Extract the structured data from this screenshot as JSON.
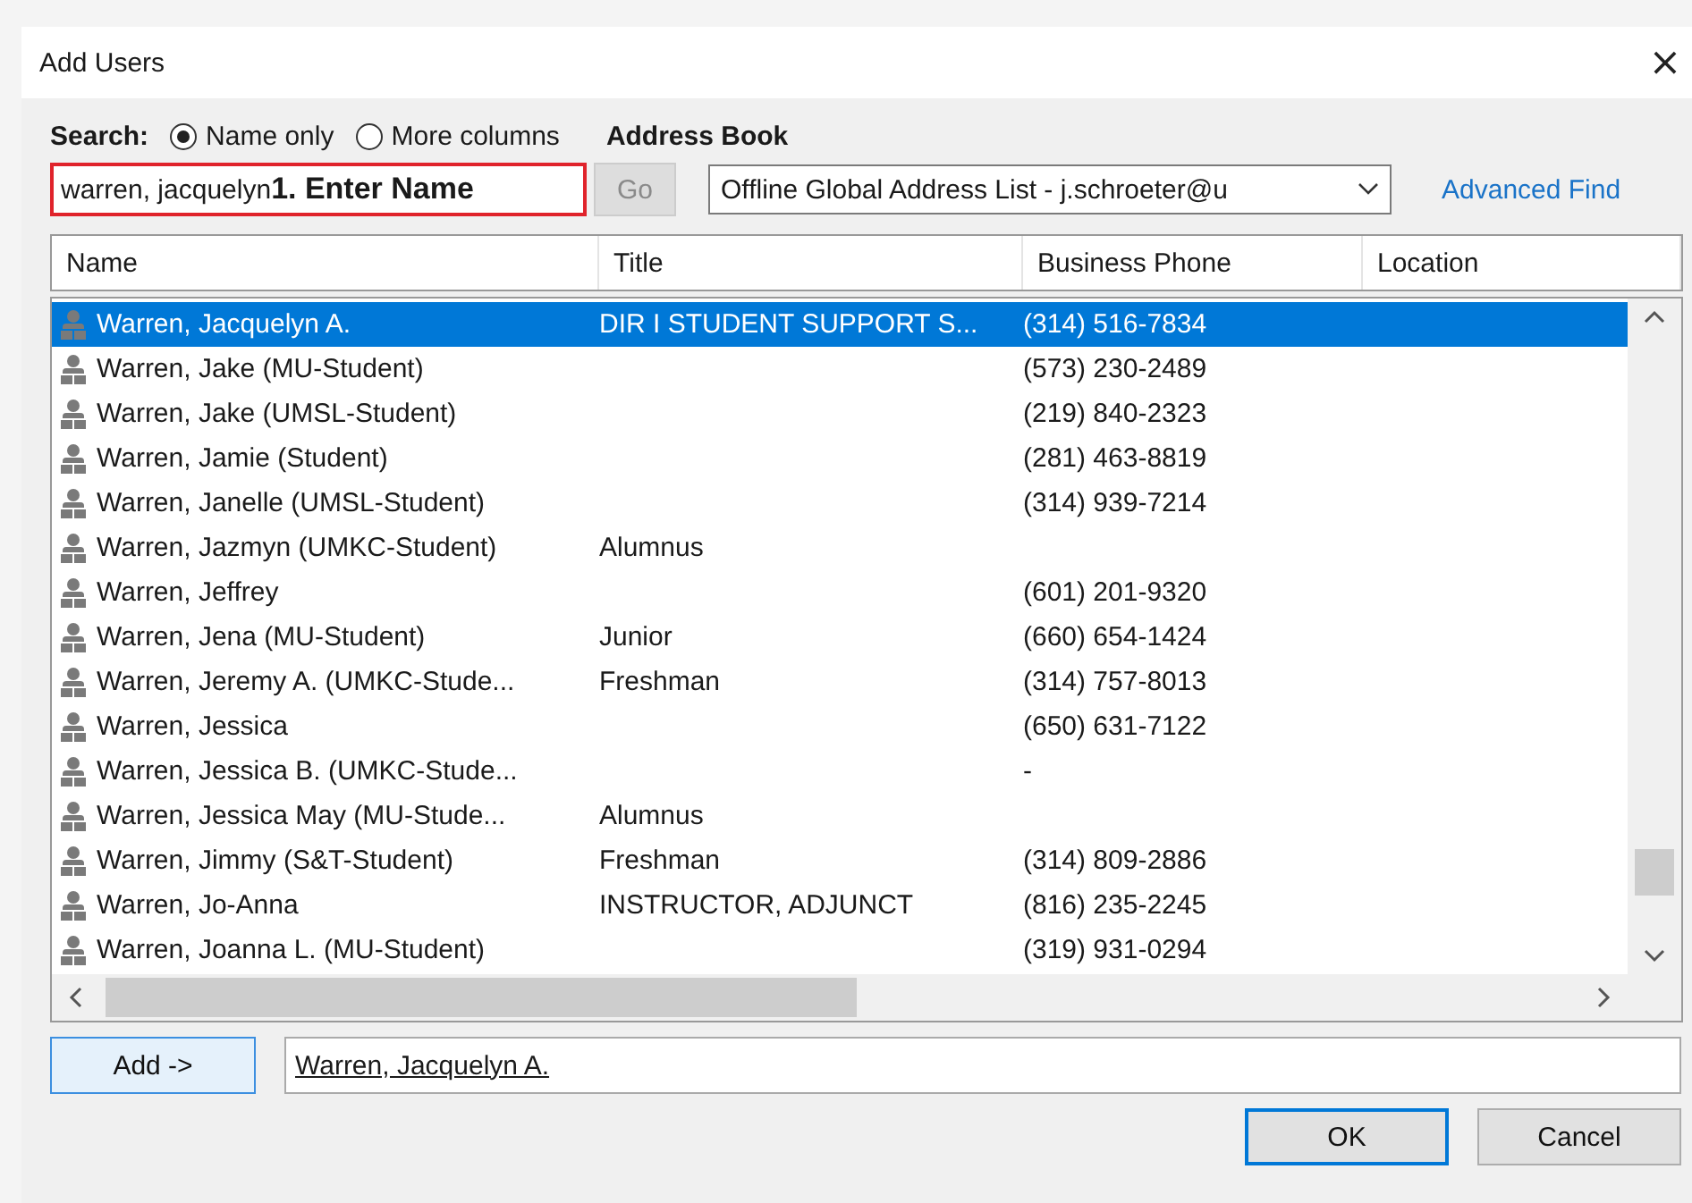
{
  "window": {
    "title": "Add Users",
    "close": "×"
  },
  "search": {
    "label": "Search:",
    "options": [
      {
        "label": "Name only",
        "selected": true
      },
      {
        "label": "More columns",
        "selected": false
      }
    ],
    "value": "warren, jacquelyn",
    "annotation": "1. Enter Name",
    "go_button": {
      "label": "Go",
      "disabled": true
    }
  },
  "address_book": {
    "label": "Address Book",
    "value": "Offline Global Address List - j.schroeter@u",
    "link": "Advanced Find"
  },
  "table": {
    "columns": [
      "Name",
      "Title",
      "Business Phone",
      "Location"
    ],
    "rows": [
      {
        "name": "Warren, Jacquelyn A.",
        "title": "DIR I STUDENT SUPPORT S...",
        "phone": "(314) 516-7834",
        "selected": true
      },
      {
        "name": "Warren, Jake (MU-Student)",
        "title": "",
        "phone": "(573) 230-2489",
        "selected": false
      },
      {
        "name": "Warren, Jake (UMSL-Student)",
        "title": "",
        "phone": "(219) 840-2323",
        "selected": false
      },
      {
        "name": "Warren, Jamie (Student)",
        "title": "",
        "phone": "(281) 463-8819",
        "selected": false
      },
      {
        "name": "Warren, Janelle (UMSL-Student)",
        "title": "",
        "phone": "(314) 939-7214",
        "selected": false
      },
      {
        "name": "Warren, Jazmyn (UMKC-Student)",
        "title": "Alumnus",
        "phone": "",
        "selected": false
      },
      {
        "name": "Warren, Jeffrey",
        "title": "",
        "phone": "(601) 201-9320",
        "selected": false
      },
      {
        "name": "Warren, Jena (MU-Student)",
        "title": "Junior",
        "phone": "(660) 654-1424",
        "selected": false
      },
      {
        "name": "Warren, Jeremy A. (UMKC-Stude...",
        "title": "Freshman",
        "phone": "(314) 757-8013",
        "selected": false
      },
      {
        "name": "Warren, Jessica",
        "title": "",
        "phone": "(650) 631-7122",
        "selected": false
      },
      {
        "name": "Warren, Jessica B. (UMKC-Stude...",
        "title": "",
        "phone": "-",
        "selected": false
      },
      {
        "name": "Warren, Jessica May (MU-Stude...",
        "title": "Alumnus",
        "phone": "",
        "selected": false
      },
      {
        "name": "Warren, Jimmy (S&T-Student)",
        "title": "Freshman",
        "phone": "(314) 809-2886",
        "selected": false
      },
      {
        "name": "Warren, Jo-Anna",
        "title": "INSTRUCTOR, ADJUNCT",
        "phone": "(816) 235-2245",
        "selected": false
      },
      {
        "name": "Warren, Joanna L. (MU-Student)",
        "title": "",
        "phone": "(319) 931-0294",
        "selected": false
      }
    ]
  },
  "add_button": "Add ->",
  "added": "Warren, Jacquelyn A.",
  "buttons": [
    {
      "label": "OK",
      "default": true
    },
    {
      "label": "Cancel",
      "default": false
    }
  ]
}
